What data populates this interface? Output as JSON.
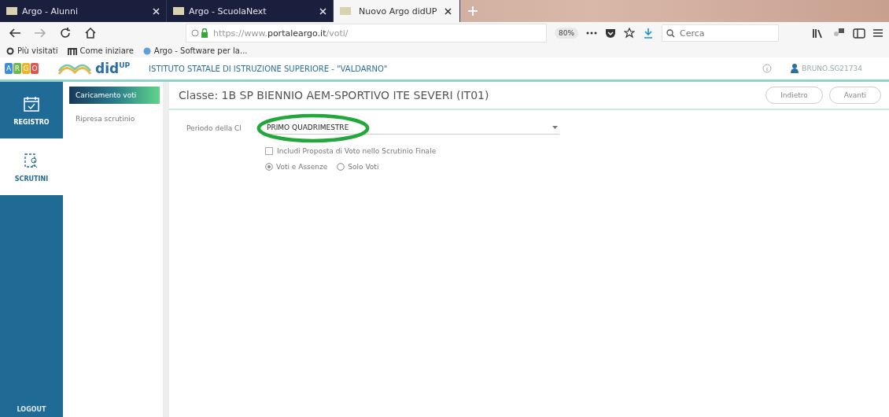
{
  "browser": {
    "tabs": [
      {
        "label": "Argo - Alunni",
        "selected": false
      },
      {
        "label": "Argo - ScuolaNext",
        "selected": false
      },
      {
        "label": "Nuovo Argo didUP",
        "selected": true
      }
    ],
    "url": {
      "prefix": "https://www.",
      "domain": "portaleargo.it",
      "path": "/voti/"
    },
    "zoom": "80%",
    "search": {
      "placeholder": "Cerca"
    },
    "bookmarks": [
      {
        "label": "Più visitati"
      },
      {
        "label": "Come iniziare"
      },
      {
        "label": "Argo - Software per la..."
      }
    ]
  },
  "app": {
    "logo_letters": [
      "A",
      "R",
      "G",
      "O"
    ],
    "brand": "did",
    "brand_sup": "UP",
    "school": "ISTITUTO STATALE DI ISTRUZIONE SUPERIORE - \"VALDARNO\"",
    "user": "BRUNO.SG21734"
  },
  "nav": [
    {
      "label": "REGISTRO",
      "selected": false
    },
    {
      "label": "SCRUTINI",
      "selected": true
    }
  ],
  "logout": "LOGOUT",
  "submenu": [
    {
      "label": "Caricamento voti",
      "selected": true
    },
    {
      "label": "Ripresa scrutinio",
      "selected": false
    }
  ],
  "page": {
    "title": "Classe: 1B SP BIENNIO AEM-SPORTIVO ITE SEVERI (IT01)",
    "buttons": [
      "Indietro",
      "Avanti"
    ],
    "period_label": "Periodo della Cl",
    "period_value": "PRIMO QUADRIMESTRE",
    "include_checkbox": {
      "label": "Includi Proposta di Voto nello Scrutinio Finale",
      "checked": false
    },
    "options": [
      {
        "label": "Voti e Assenze",
        "selected": true
      },
      {
        "label": "Solo Voti",
        "selected": false
      }
    ]
  }
}
